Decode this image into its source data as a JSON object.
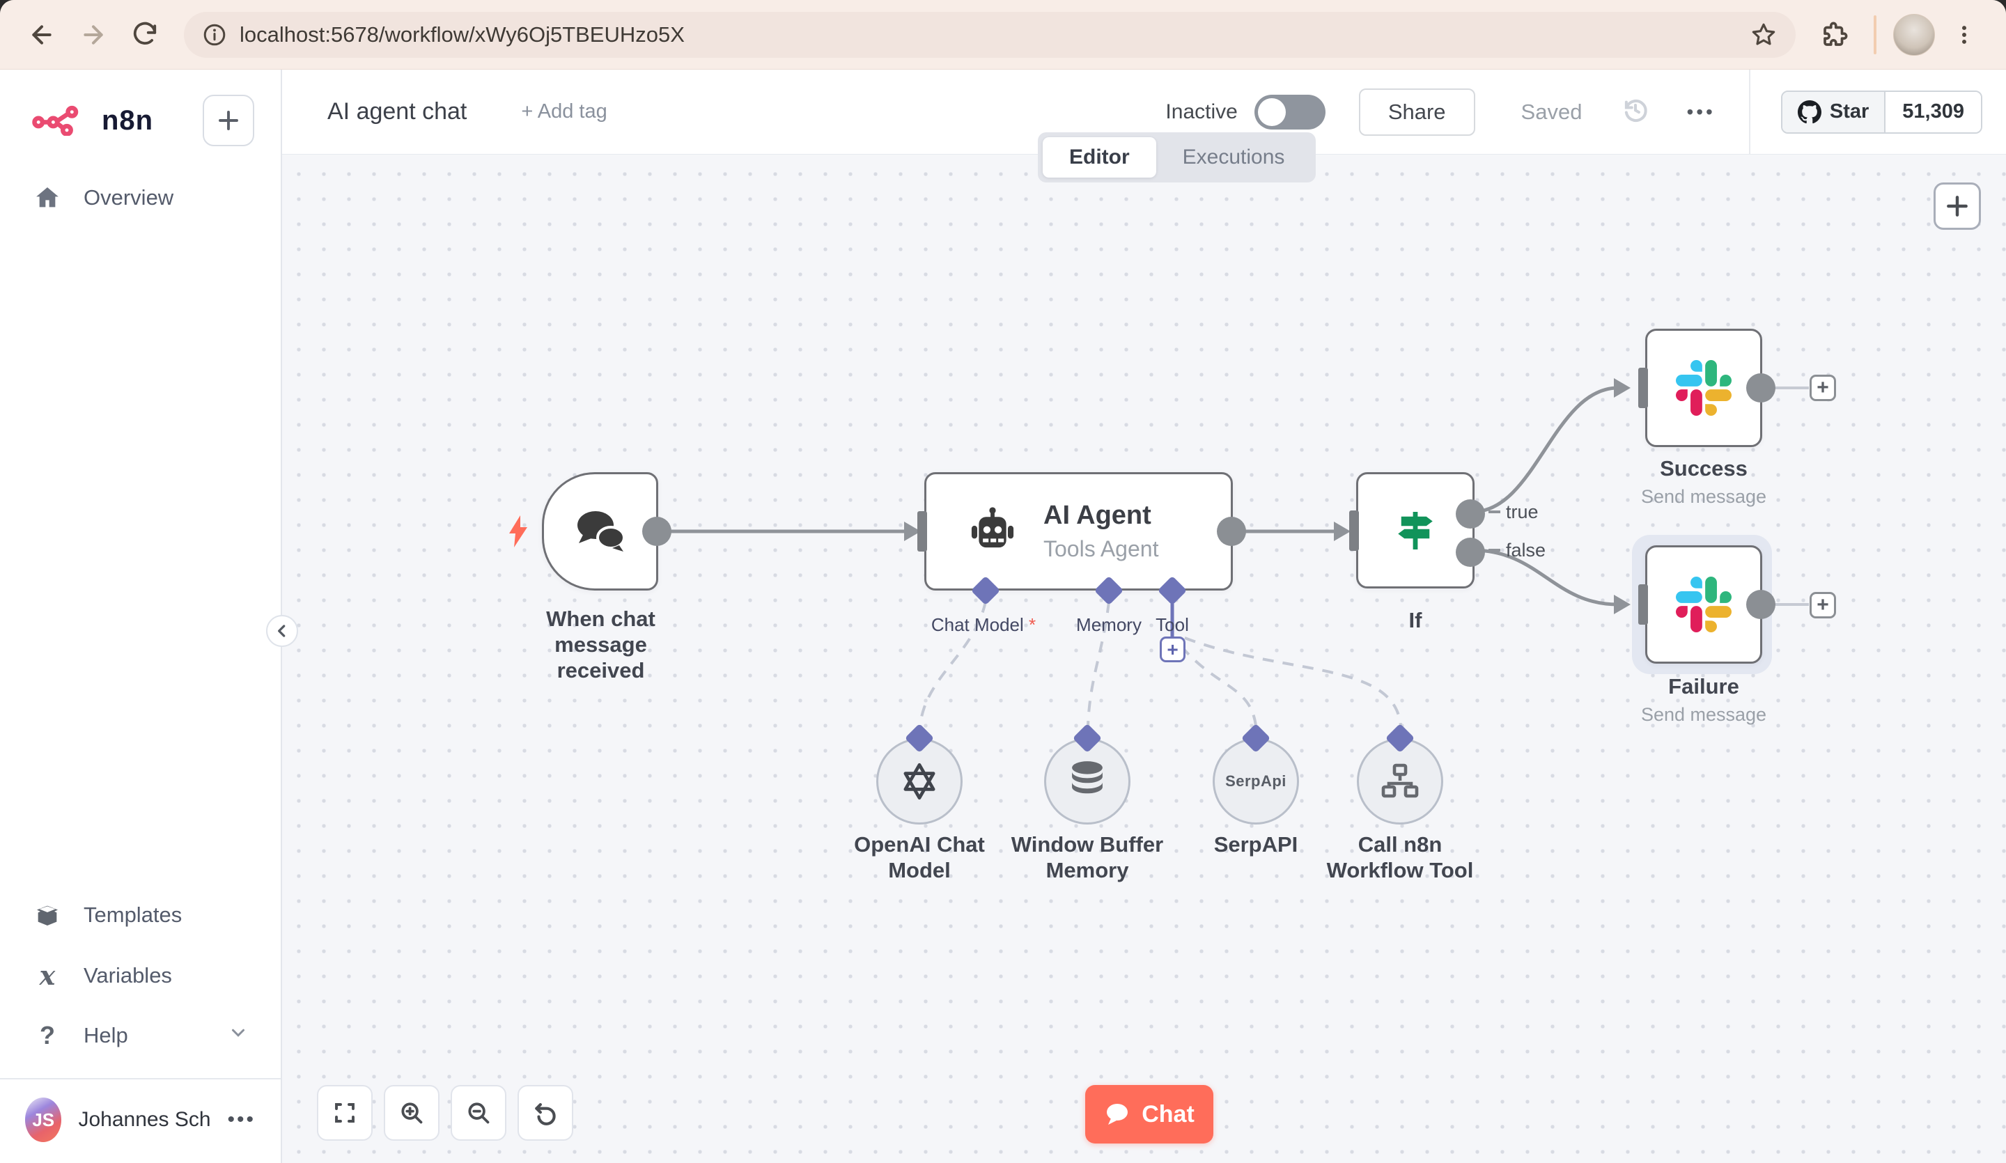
{
  "browser": {
    "url": "localhost:5678/workflow/xWy6Oj5TBEUHzo5X"
  },
  "sidebar": {
    "brand": "n8n",
    "overview": "Overview",
    "templates": "Templates",
    "variables": "Variables",
    "variables_icon_glyph": "x",
    "help": "Help",
    "help_icon_glyph": "?",
    "user_name": "Johannes Schn...",
    "user_initials": "JS",
    "user_menu_dots": "•••"
  },
  "header": {
    "title": "AI agent chat",
    "add_tag": "+ Add tag",
    "inactive_label": "Inactive",
    "share_label": "Share",
    "saved_label": "Saved",
    "menu_dots": "•••",
    "github": {
      "star_label": "Star",
      "star_count": "51,309"
    }
  },
  "tabs": {
    "editor": "Editor",
    "executions": "Executions"
  },
  "canvas": {
    "trigger": {
      "label": "When chat message received"
    },
    "agent": {
      "title": "AI Agent",
      "subtitle": "Tools Agent",
      "connectors": {
        "chat_model": "Chat Model",
        "required_marker": "*",
        "memory": "Memory",
        "tool": "Tool"
      }
    },
    "if_node": {
      "label": "If",
      "true_label": "true",
      "false_label": "false"
    },
    "success": {
      "label": "Success",
      "subtitle": "Send message"
    },
    "failure": {
      "label": "Failure",
      "subtitle": "Send message"
    },
    "openai": {
      "label": "OpenAI Chat Model"
    },
    "buffer_memory": {
      "label": "Window Buffer Memory"
    },
    "serpapi": {
      "label": "SerpAPI",
      "logo_text": "SerpApi"
    },
    "call_workflow": {
      "label": "Call n8n Workflow Tool"
    },
    "chat_button": "Chat",
    "plus_glyph": "+"
  },
  "colors": {
    "brand_pink": "#ea4b71",
    "chat_button": "#ff6d5a",
    "ai_connector": "#6e74b8",
    "if_green": "#11935a",
    "slack_blue": "#36c5f0",
    "slack_green": "#2eb67d",
    "slack_yellow": "#ecb22e",
    "slack_red": "#e01e5a"
  }
}
